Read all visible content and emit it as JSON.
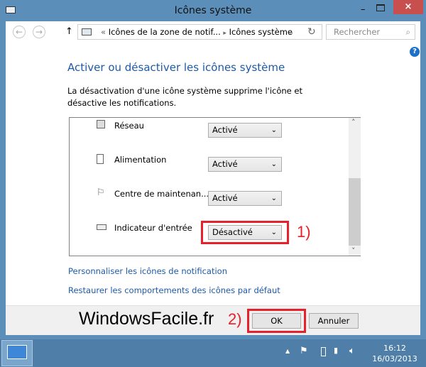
{
  "window": {
    "title": "Icônes système",
    "close_icon": "×",
    "minimize_icon": "–"
  },
  "nav": {
    "back": "←",
    "forward": "→",
    "up": "↑",
    "breadcrumb_sep": "«",
    "crumb1": "Icônes de la zone de notif...",
    "arrow": "▸",
    "crumb2": "Icônes système",
    "dropdown": "⌄",
    "refresh": "↻",
    "search_placeholder": "Rechercher",
    "search_icon": "⌕"
  },
  "help_icon": "?",
  "heading": "Activer ou désactiver les icônes système",
  "description": "La désactivation d'une icône système supprime l'icône et désactive les notifications.",
  "items": [
    {
      "label": "Réseau",
      "value": "Activé",
      "icon": "network-icon"
    },
    {
      "label": "Alimentation",
      "value": "Activé",
      "icon": "power-icon"
    },
    {
      "label": "Centre de maintenan...",
      "value": "Activé",
      "icon": "flag-icon"
    },
    {
      "label": "Indicateur d'entrée",
      "value": "Désactivé",
      "icon": "keyboard-icon"
    }
  ],
  "scroll": {
    "up": "˄",
    "down": "˅"
  },
  "links": {
    "customize": "Personnaliser les icônes de notification",
    "restore": "Restaurer les comportements des icônes par défaut"
  },
  "footer": {
    "watermark": "WindowsFacile.fr",
    "ok": "OK",
    "cancel": "Annuler"
  },
  "annotations": {
    "a1": "1)",
    "a2": "2)"
  },
  "taskbar": {
    "time": "16:12",
    "date": "16/03/2013",
    "tray_up": "▲"
  },
  "colors": {
    "accent": "#1e5aa8",
    "highlight": "#e8202a",
    "frame": "#5b8fba"
  }
}
